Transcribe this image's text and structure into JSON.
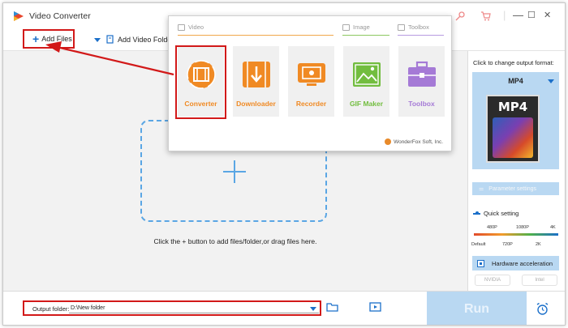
{
  "window": {
    "title": "Video Converter",
    "controls": [
      "—",
      "☐",
      "✕"
    ]
  },
  "toolbar": {
    "add_files_label": "Add Files",
    "add_video_folder_label": "Add Video Folder"
  },
  "main": {
    "hint": "Click the + button to add files/folder,or drag files here."
  },
  "popup": {
    "sections": {
      "video": "Video",
      "image": "Image",
      "toolbox": "Toolbox"
    },
    "tiles": [
      {
        "label": "Converter",
        "icon": "film-icon"
      },
      {
        "label": "Downloader",
        "icon": "download-icon"
      },
      {
        "label": "Recorder",
        "icon": "screen-record-icon"
      },
      {
        "label": "GIF Maker",
        "icon": "image-icon"
      },
      {
        "label": "Toolbox",
        "icon": "toolbox-icon"
      }
    ],
    "footer": "WonderFox Soft, Inc."
  },
  "right_panel": {
    "label": "Click to change output format:",
    "format": "MP4",
    "format_icon_text": "MP4",
    "parameter_settings": "Parameter settings",
    "quick_setting": "Quick setting",
    "scale_top": [
      "480P",
      "1080P",
      "4K"
    ],
    "scale_bottom": [
      "Default",
      "720P",
      "2K"
    ],
    "hardware_acceleration": "Hardware acceleration",
    "brands": [
      "NVIDIA",
      "Intel"
    ]
  },
  "bottom": {
    "output_folder_label": "Output folder:",
    "output_folder_value": "D:\\New folder",
    "run_label": "Run"
  },
  "colors": {
    "accent_blue": "#1b6fc9",
    "annotation_red": "#d21919",
    "tile_orange": "#f08a24",
    "tile_green": "#72bd3f",
    "tile_purple": "#a57ad6",
    "light_blue": "#b9d8f2"
  }
}
